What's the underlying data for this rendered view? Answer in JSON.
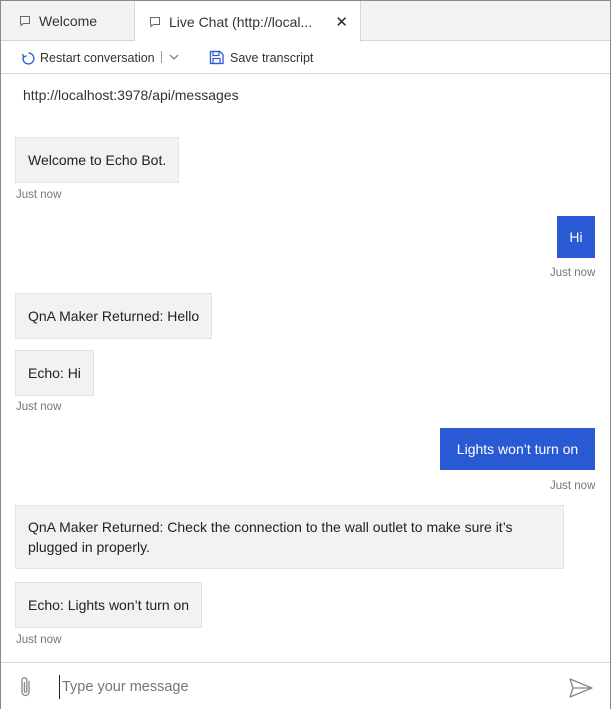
{
  "tabs": {
    "welcome": "Welcome",
    "live": "Live Chat (http://local..."
  },
  "toolbar": {
    "restart_label": "Restart conversation",
    "save_label": "Save transcript"
  },
  "endpoint": "http://localhost:3978/api/messages",
  "messages": [
    {
      "from": "bot",
      "text": "Welcome to Echo Bot."
    },
    {
      "from": "user",
      "text": "Hi"
    },
    {
      "from": "bot",
      "text": "QnA Maker Returned: Hello"
    },
    {
      "from": "bot",
      "text": "Echo: Hi"
    },
    {
      "from": "user",
      "text": "Lights won’t turn on"
    },
    {
      "from": "bot",
      "text": "QnA Maker Returned: Check the connection to the wall outlet to make sure it’s plugged in properly."
    },
    {
      "from": "bot",
      "text": "Echo: Lights won’t turn on"
    }
  ],
  "timestamps": [
    "Just now",
    "Just now",
    "Just now",
    "Just now",
    "Just now"
  ],
  "composer": {
    "placeholder": "Type your message"
  },
  "icons": {
    "tab": "chat-doc-icon",
    "close": "close-icon",
    "restart": "refresh-icon",
    "chevron": "chevron-down-icon",
    "save": "save-icon",
    "attach": "paperclip-icon",
    "send": "send-icon"
  },
  "colors": {
    "user_bubble": "#2a5ad3",
    "bot_bubble": "#f2f2f2",
    "accent": "#2a5ad3"
  }
}
